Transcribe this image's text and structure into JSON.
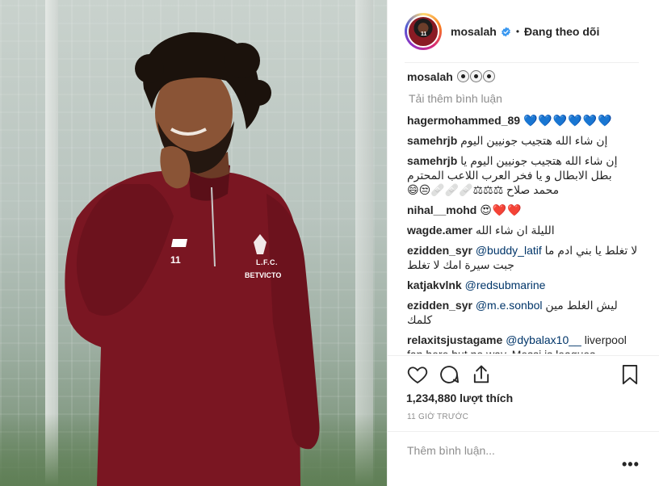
{
  "photo": {
    "kit_number": "11",
    "club": "L.F.C.",
    "sponsor": "BETVICTO"
  },
  "header": {
    "username": "mosalah",
    "separator": "•",
    "follow_label": "Đang theo dõi",
    "avatar_number": "11"
  },
  "caption": {
    "username": "mosalah",
    "text": "⚽⚽⚽"
  },
  "load_more_label": "Tải thêm bình luận",
  "comments": [
    {
      "username": "hagermohammed_89",
      "text": "💙💙💙💙💙💙",
      "style": "heart-b"
    },
    {
      "username": "samehrjb",
      "text": "إن شاء الله هتجيب جونيين اليوم",
      "style": "rtl"
    },
    {
      "username": "samehrjb",
      "text": "إن شاء الله هتجيب جونيين اليوم يا بطل الابطال و يا فخر العرب اللاعب المحترم محمد صلاح ⚖⚖⚖🩹🩹🩹😒😄",
      "style": "rtl"
    },
    {
      "username": "nihal__mohd",
      "text": "😍❤️❤️",
      "style": "heart-r"
    },
    {
      "username": "wagde.amer",
      "text": "الليلة ان شاء الله",
      "style": "rtl"
    },
    {
      "username": "ezidden_syr",
      "mention": "@buddy_latif",
      "text": "لا تغلط يا بني ادم ما جبت سيرة امك لا تغلط",
      "style": "rtl"
    },
    {
      "username": "katjakvlnk",
      "mention": "@redsubmarine",
      "text": "",
      "style": ""
    },
    {
      "username": "ezidden_syr",
      "mention": "@m.e.sonbol",
      "text": "ليش الغلط مين كلمك",
      "style": "rtl"
    },
    {
      "username": "relaxitsjustagame",
      "mention": "@dybalax10__",
      "text": "liverpool fan here but no way. Messi is leagues",
      "style": ""
    }
  ],
  "likes_label": "1,234,880 lượt thích",
  "time_label": "11 GIỜ TRƯỚC",
  "add_comment_placeholder": "Thêm bình luận...",
  "more_label": "•••",
  "colors": {
    "username": "#262626",
    "secondary": "#8e8e8e",
    "mention": "#003569",
    "border": "#efefef",
    "jersey": "#7a1622"
  },
  "icons": [
    "heart-icon",
    "comment-icon",
    "share-icon",
    "bookmark-icon",
    "verified-badge-icon"
  ]
}
